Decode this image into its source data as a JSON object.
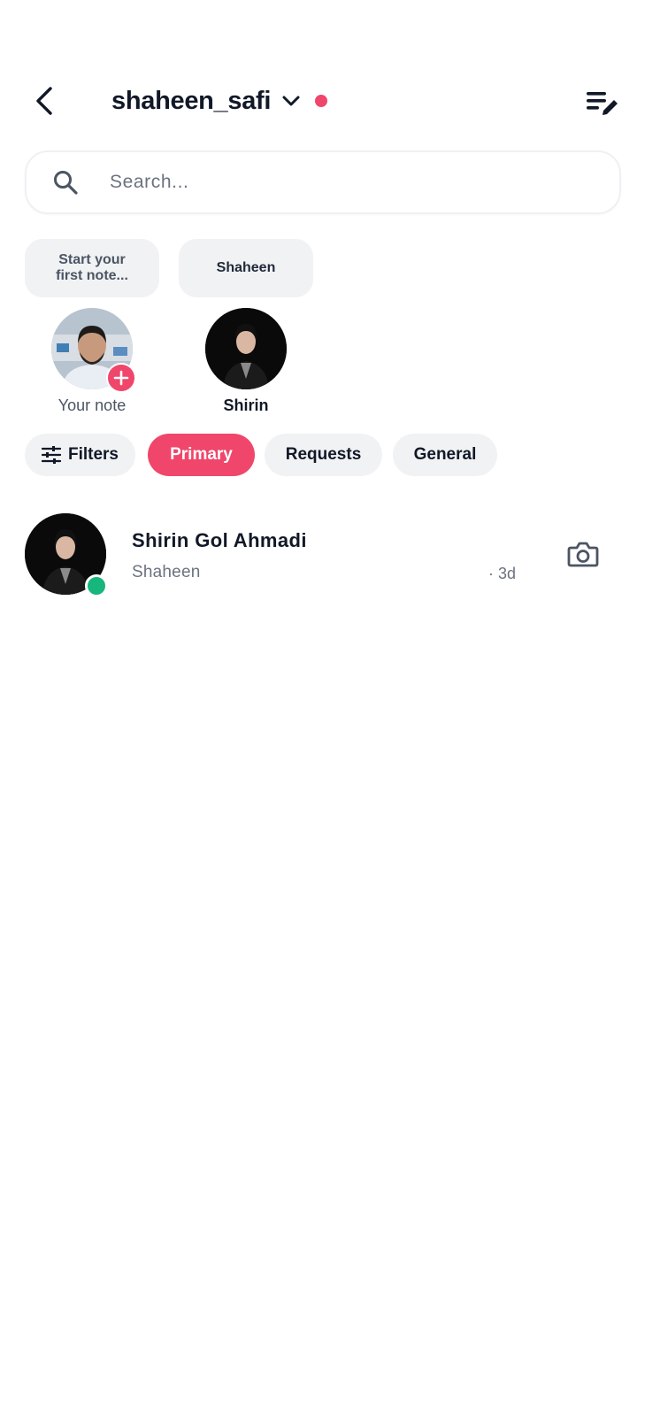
{
  "header": {
    "account_name": "shaheen_safi",
    "back_icon": "chevron-left-icon",
    "dropdown_icon": "chevron-down-icon",
    "compose_icon": "compose-list-icon",
    "status_color": "#f0466b"
  },
  "search": {
    "placeholder": "Search...",
    "icon": "search-icon"
  },
  "notes": [
    {
      "bubble_line1": "Start your",
      "bubble_line2": "first note...",
      "label": "Your note",
      "is_self": true
    },
    {
      "bubble": "Shaheen",
      "label": "Shirin",
      "is_self": false
    }
  ],
  "filters": {
    "filters_label": "Filters",
    "tabs": [
      {
        "label": "Primary",
        "active": true
      },
      {
        "label": "Requests",
        "active": false
      },
      {
        "label": "General",
        "active": false
      }
    ]
  },
  "conversations": [
    {
      "name": "Shirin Gol Ahmadi",
      "preview": "Shaheen",
      "time": "· 3d",
      "online": true,
      "action_icon": "camera-icon"
    }
  ],
  "colors": {
    "accent": "#f0466b",
    "online": "#16b67d",
    "chip_bg": "#f1f2f4"
  }
}
